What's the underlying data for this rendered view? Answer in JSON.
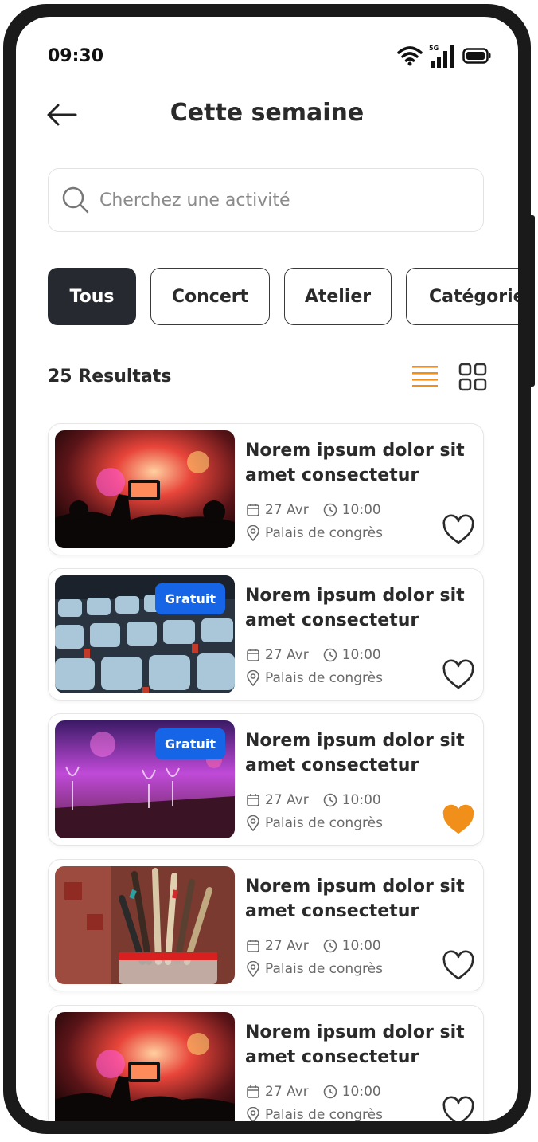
{
  "status_bar": {
    "time": "09:30",
    "network": "5G"
  },
  "header": {
    "title": "Cette semaine"
  },
  "search": {
    "placeholder": "Cherchez une activité"
  },
  "filters": [
    "Tous",
    "Concert",
    "Atelier",
    "Catégorie"
  ],
  "filters_active": "Tous",
  "results": {
    "count_label": "25 Resultats"
  },
  "view_toggle": {
    "active": "list",
    "accent": "#f0901a"
  },
  "events": [
    {
      "title": "Norem ipsum dolor sit amet consectetur",
      "date": "27 Avr",
      "time": "10:00",
      "location": "Palais de congrès",
      "badge": "",
      "favorite": false,
      "image": "concert-crowd"
    },
    {
      "title": "Norem ipsum dolor sit amet consectetur",
      "date": "27 Avr",
      "time": "10:00",
      "location": "Palais de congrès",
      "badge": "Gratuit",
      "favorite": false,
      "image": "theater-seats"
    },
    {
      "title": "Norem ipsum dolor sit amet consectetur",
      "date": "27 Avr",
      "time": "10:00",
      "location": "Palais de congrès",
      "badge": "Gratuit",
      "favorite": true,
      "image": "banquet-table"
    },
    {
      "title": "Norem ipsum dolor sit amet consectetur",
      "date": "27 Avr",
      "time": "10:00",
      "location": "Palais de congrès",
      "badge": "",
      "favorite": false,
      "image": "paint-brushes"
    },
    {
      "title": "Norem ipsum dolor sit amet consectetur",
      "date": "27 Avr",
      "time": "10:00",
      "location": "Palais de congrès",
      "badge": "",
      "favorite": false,
      "image": "concert-crowd"
    }
  ],
  "colors": {
    "accent": "#f0901a",
    "badge": "#1565e6",
    "chip_active": "#262a30"
  }
}
